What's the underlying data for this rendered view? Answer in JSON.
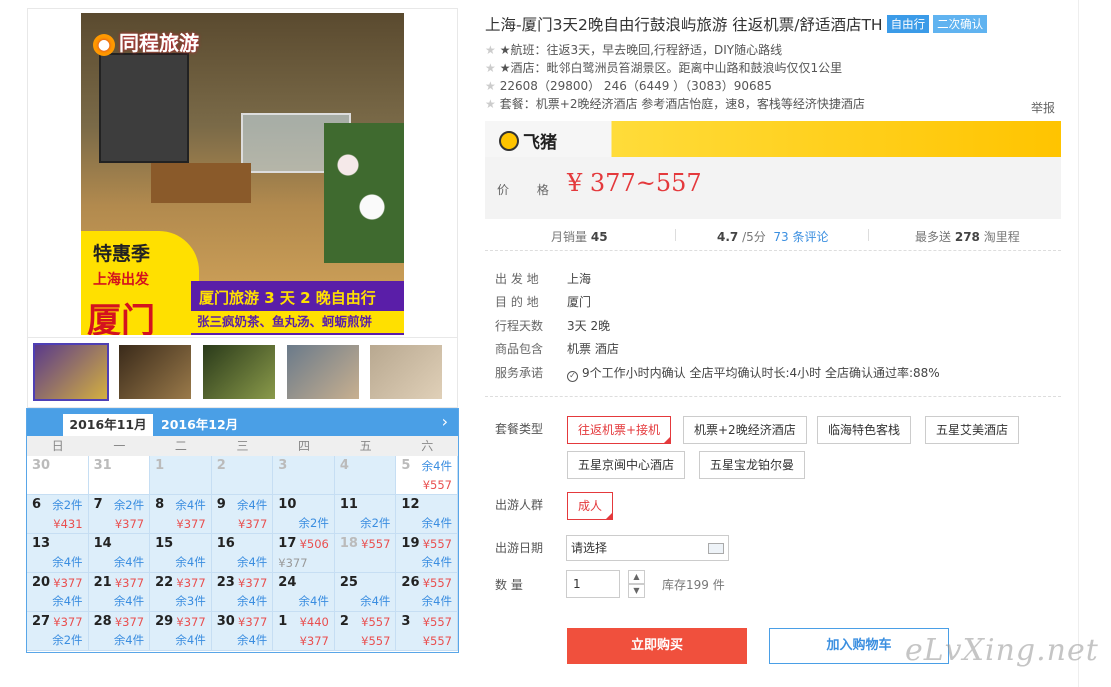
{
  "images": {
    "hero_brand": "同程旅游",
    "promo_tag": "特惠季",
    "promo_depart": "上海出发",
    "promo_city": "厦门",
    "promo_title": "厦门旅游 3 天 2 晚自由行",
    "promo_foods": "张三疯奶茶、鱼丸汤、蚵蛎煎饼"
  },
  "calendar": {
    "tab_current": "2016年11月",
    "tab_next": "2016年12月",
    "weekdays": [
      "日",
      "一",
      "二",
      "三",
      "四",
      "五",
      "六"
    ],
    "cells": [
      {
        "d": "30",
        "type": "muted"
      },
      {
        "d": "31",
        "type": "muted"
      },
      {
        "d": "1",
        "type": "past"
      },
      {
        "d": "2",
        "type": "past"
      },
      {
        "d": "3",
        "type": "past"
      },
      {
        "d": "4",
        "type": "past"
      },
      {
        "d": "5",
        "r": "余4件",
        "p": "¥557",
        "type": "muted"
      },
      {
        "d": "6",
        "r": "余2件",
        "p": "¥431",
        "type": "avail"
      },
      {
        "d": "7",
        "r": "余2件",
        "p": "¥377",
        "type": "avail"
      },
      {
        "d": "8",
        "r": "余4件",
        "p": "¥377",
        "type": "avail"
      },
      {
        "d": "9",
        "r": "余4件",
        "p": "¥377",
        "type": "avail"
      },
      {
        "d": "10",
        "s": "余2件",
        "type": "avail"
      },
      {
        "d": "11",
        "s": "余2件",
        "type": "avail"
      },
      {
        "d": "12",
        "s": "余4件",
        "type": "avail"
      },
      {
        "d": "13",
        "s": "余4件",
        "type": "avail"
      },
      {
        "d": "14",
        "s": "余4件",
        "type": "avail"
      },
      {
        "d": "15",
        "s": "余4件",
        "type": "avail"
      },
      {
        "d": "16",
        "s": "余4件",
        "type": "avail"
      },
      {
        "d": "17",
        "rs": "¥506",
        "g": "¥377",
        "type": "avail"
      },
      {
        "d": "18",
        "rs": "¥557",
        "type": "past"
      },
      {
        "d": "19",
        "rs": "¥557",
        "s": "余4件",
        "type": "avail"
      },
      {
        "d": "20",
        "rs": "¥377",
        "s": "余4件",
        "type": "avail"
      },
      {
        "d": "21",
        "rs": "¥377",
        "s": "余4件",
        "type": "avail"
      },
      {
        "d": "22",
        "rs": "¥377",
        "s": "余3件",
        "type": "avail"
      },
      {
        "d": "23",
        "rs": "¥377",
        "s": "余4件",
        "type": "avail"
      },
      {
        "d": "24",
        "s": "余4件",
        "type": "avail"
      },
      {
        "d": "25",
        "s": "余4件",
        "type": "avail"
      },
      {
        "d": "26",
        "rs": "¥557",
        "s": "余4件",
        "type": "avail"
      },
      {
        "d": "27",
        "rs": "¥377",
        "s": "余2件",
        "type": "avail"
      },
      {
        "d": "28",
        "rs": "¥377",
        "s": "余4件",
        "type": "avail"
      },
      {
        "d": "29",
        "rs": "¥377",
        "s": "余4件",
        "type": "avail"
      },
      {
        "d": "30",
        "rs": "¥377",
        "s": "余4件",
        "type": "avail"
      },
      {
        "d": "1",
        "rs": "¥440",
        "p": "¥377",
        "type": "avail"
      },
      {
        "d": "2",
        "rs": "¥557",
        "p": "¥557",
        "type": "avail"
      },
      {
        "d": "3",
        "rs": "¥557",
        "p": "¥557",
        "type": "avail"
      }
    ]
  },
  "product": {
    "title": "上海-厦门3天2晚自由行鼓浪屿旅游 往返机票/舒适酒店TH",
    "badge_1": "自由行",
    "badge_2": "二次确认",
    "features": [
      "★航班：往返3天，早去晚回,行程舒适，DIY随心路线",
      "★酒店：毗邻白鹭洲员笞湖景区。距离中山路和鼓浪屿仅仅1公里",
      "22608（29800） 246（6449 ）（3083）90685",
      "套餐：机票+2晚经济酒店 参考酒店怡庭，速8，客栈等经济快捷酒店"
    ],
    "report_label": "举报",
    "platform": "飞猪",
    "price_label": "价 格",
    "price": "¥ 377~557",
    "monthly_sales_label": "月销量",
    "monthly_sales": "45",
    "rating": "4.7",
    "rating_suffix": "/5分",
    "reviews": "73 条评论",
    "points_prefix": "最多送",
    "points_value": "278",
    "points_suffix": "淘里程",
    "info": [
      {
        "k": "出 发 地",
        "v": "上海"
      },
      {
        "k": "目 的 地",
        "v": "厦门"
      },
      {
        "k": "行程天数",
        "v": "3天 2晚"
      },
      {
        "k": "商品包含",
        "v": "机票  酒店"
      },
      {
        "k": "服务承诺",
        "v": "9个工作小时内确认    全店平均确认时长:4小时    全店确认通过率:88%"
      }
    ],
    "package_label": "套餐类型",
    "packages": [
      "往返机票+接机",
      "机票+2晚经济酒店",
      "临海特色客栈",
      "五星艾美酒店",
      "五星京闽中心酒店",
      "五星宝龙铂尔曼"
    ],
    "crowd_label": "出游人群",
    "crowd": "成人",
    "date_label": "出游日期",
    "date_placeholder": "请选择",
    "qty_label": "数    量",
    "qty": "1",
    "stock": "库存199 件",
    "buy_label": "立即购买",
    "cart_label": "加入购物车",
    "watermark": "eLvXing.net"
  }
}
